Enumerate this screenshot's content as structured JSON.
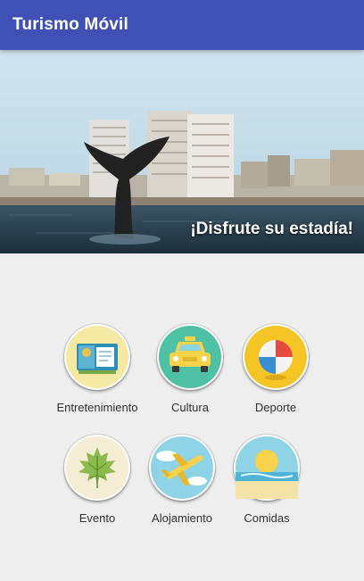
{
  "app": {
    "title": "Turismo Móvil"
  },
  "hero": {
    "tagline": "¡Disfrute su estadía!"
  },
  "categories": [
    {
      "label": "Entretenimiento",
      "icon": "film-ticket-icon"
    },
    {
      "label": "Cultura",
      "icon": "taxi-car-icon"
    },
    {
      "label": "Deporte",
      "icon": "beach-ball-icon"
    },
    {
      "label": "Evento",
      "icon": "maple-leaf-icon"
    },
    {
      "label": "Alojamiento",
      "icon": "airplane-icon"
    },
    {
      "label": "Comidas",
      "icon": "sun-beach-icon"
    }
  ]
}
